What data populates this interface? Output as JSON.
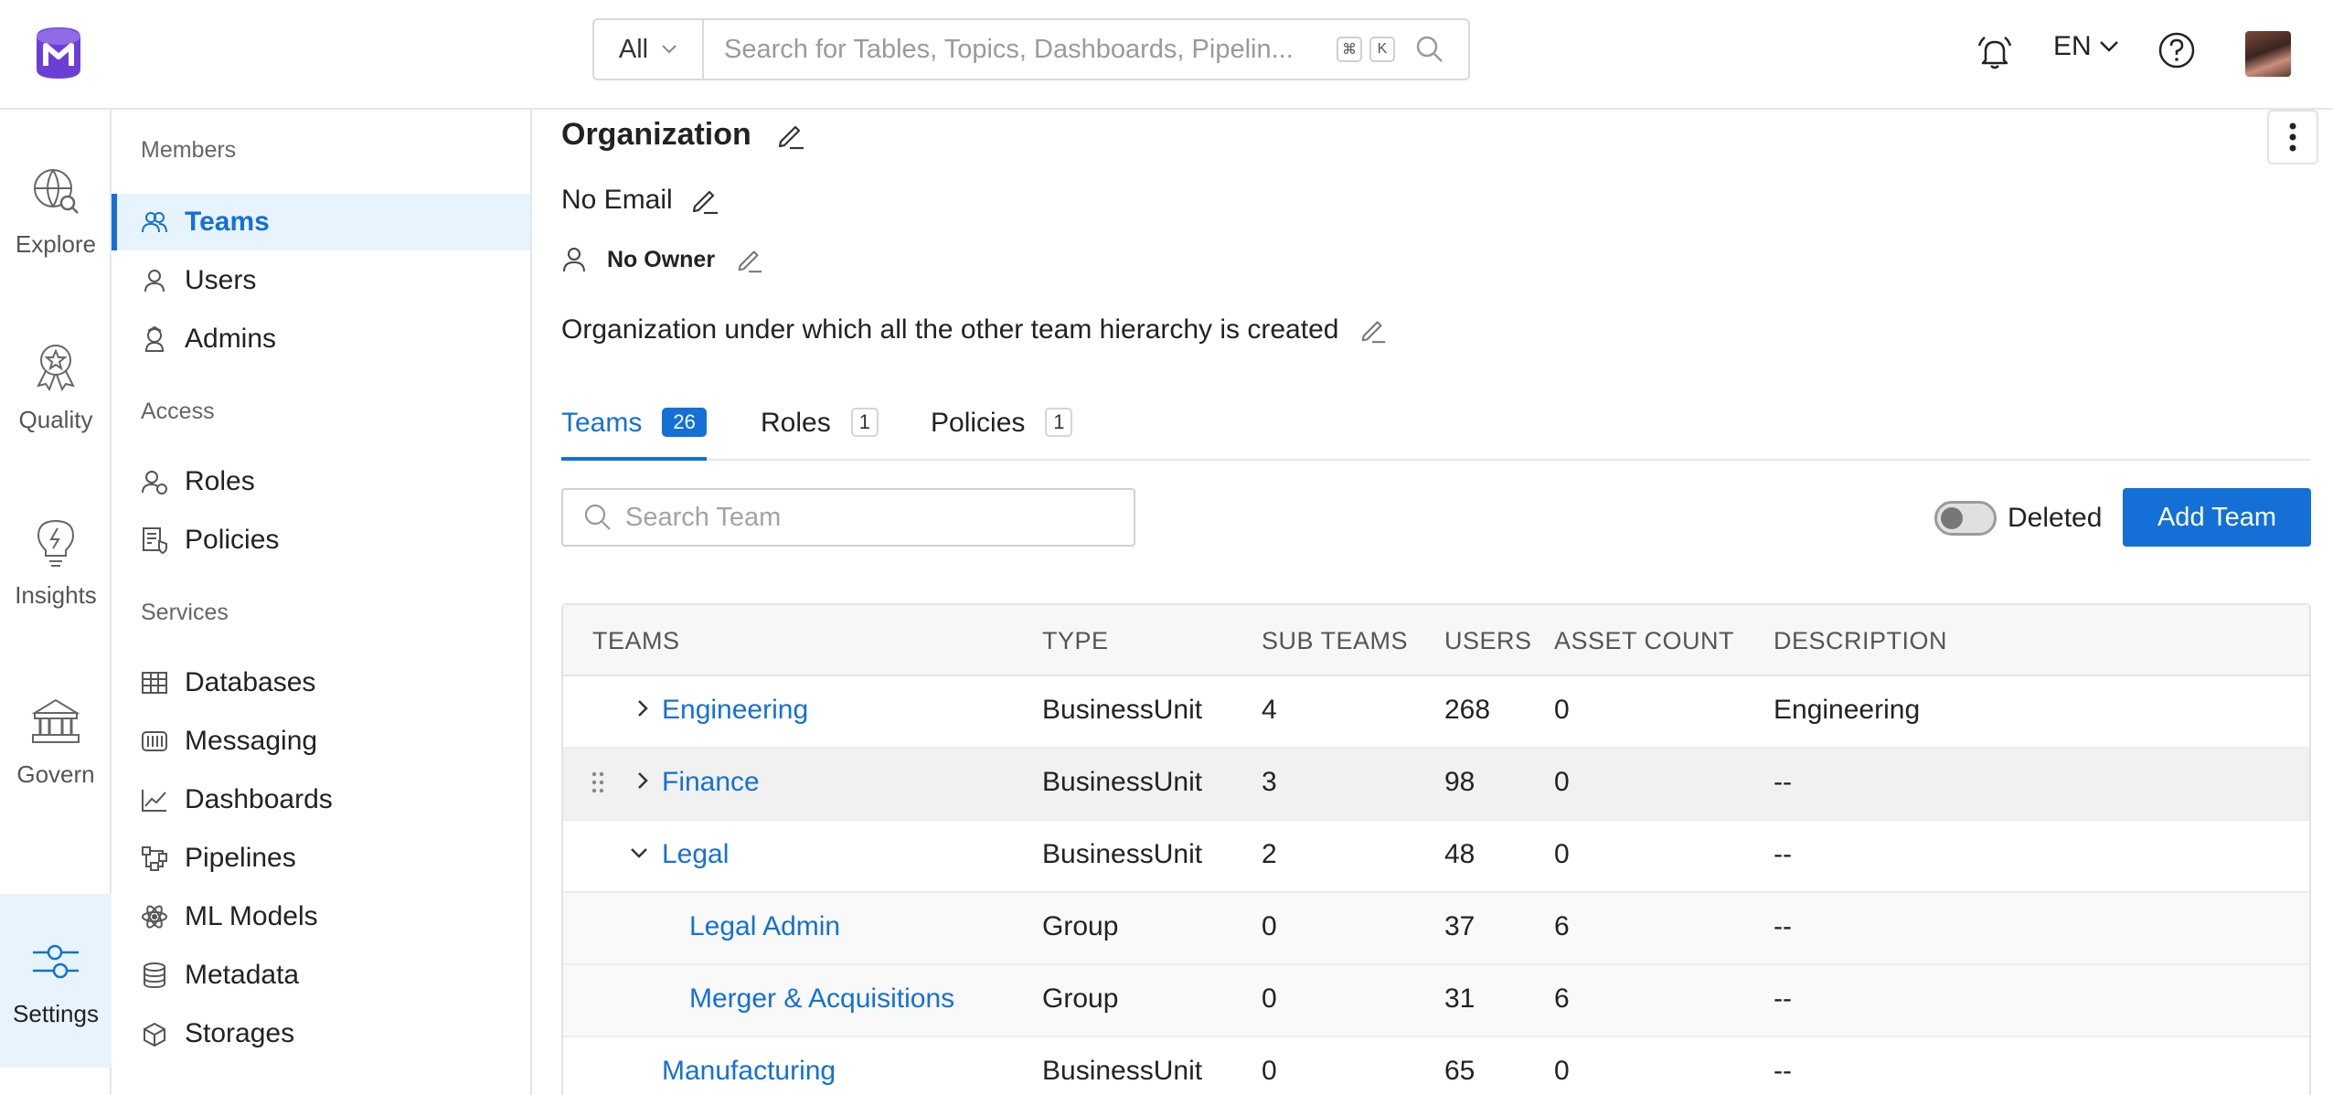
{
  "topbar": {
    "search": {
      "scope": "All",
      "placeholder": "Search for Tables, Topics, Dashboards, Pipelin...",
      "shortcut_cmd": "⌘",
      "shortcut_key": "K"
    },
    "language": "EN"
  },
  "rail": {
    "items": [
      {
        "label": "Explore",
        "icon": "explore-icon"
      },
      {
        "label": "Quality",
        "icon": "quality-icon"
      },
      {
        "label": "Insights",
        "icon": "insights-icon"
      },
      {
        "label": "Govern",
        "icon": "govern-icon"
      },
      {
        "label": "Settings",
        "icon": "settings-icon",
        "active": true
      }
    ]
  },
  "sidebar": {
    "sections": {
      "members": "Members",
      "access": "Access",
      "services": "Services"
    },
    "items": [
      {
        "label": "Teams",
        "icon": "teams-icon",
        "active": true
      },
      {
        "label": "Users",
        "icon": "user-icon"
      },
      {
        "label": "Admins",
        "icon": "admin-icon"
      },
      {
        "label": "Roles",
        "icon": "roles-icon"
      },
      {
        "label": "Policies",
        "icon": "policies-icon"
      },
      {
        "label": "Databases",
        "icon": "database-icon"
      },
      {
        "label": "Messaging",
        "icon": "messaging-icon"
      },
      {
        "label": "Dashboards",
        "icon": "dashboard-icon"
      },
      {
        "label": "Pipelines",
        "icon": "pipeline-icon"
      },
      {
        "label": "ML Models",
        "icon": "ml-model-icon"
      },
      {
        "label": "Metadata",
        "icon": "metadata-icon"
      },
      {
        "label": "Storages",
        "icon": "storage-icon"
      }
    ]
  },
  "main": {
    "title": "Organization",
    "email": "No Email",
    "owner": "No Owner",
    "description": "Organization under which all the other team hierarchy is created",
    "tabs": [
      {
        "label": "Teams",
        "count": "26",
        "active": true
      },
      {
        "label": "Roles",
        "count": "1"
      },
      {
        "label": "Policies",
        "count": "1"
      }
    ],
    "team_search_placeholder": "Search Team",
    "deleted_label": "Deleted",
    "add_team_label": "Add Team",
    "table": {
      "headers": [
        "TEAMS",
        "TYPE",
        "SUB TEAMS",
        "USERS",
        "ASSET COUNT",
        "DESCRIPTION"
      ],
      "rows": [
        {
          "name": "Engineering",
          "type": "BusinessUnit",
          "sub_teams": "4",
          "users": "268",
          "asset_count": "0",
          "description": "Engineering"
        },
        {
          "name": "Finance",
          "type": "BusinessUnit",
          "sub_teams": "3",
          "users": "98",
          "asset_count": "0",
          "description": "--"
        },
        {
          "name": "Legal",
          "type": "BusinessUnit",
          "sub_teams": "2",
          "users": "48",
          "asset_count": "0",
          "description": "--"
        },
        {
          "name": "Legal Admin",
          "type": "Group",
          "sub_teams": "0",
          "users": "37",
          "asset_count": "6",
          "description": "--"
        },
        {
          "name": "Merger & Acquisitions",
          "type": "Group",
          "sub_teams": "0",
          "users": "31",
          "asset_count": "6",
          "description": "--"
        },
        {
          "name": "Manufacturing",
          "type": "BusinessUnit",
          "sub_teams": "0",
          "users": "65",
          "asset_count": "0",
          "description": "--"
        }
      ]
    }
  },
  "colors": {
    "accent": "#1470d6",
    "active_bg": "#e8f4fd",
    "logo": "#6b3fd6"
  }
}
